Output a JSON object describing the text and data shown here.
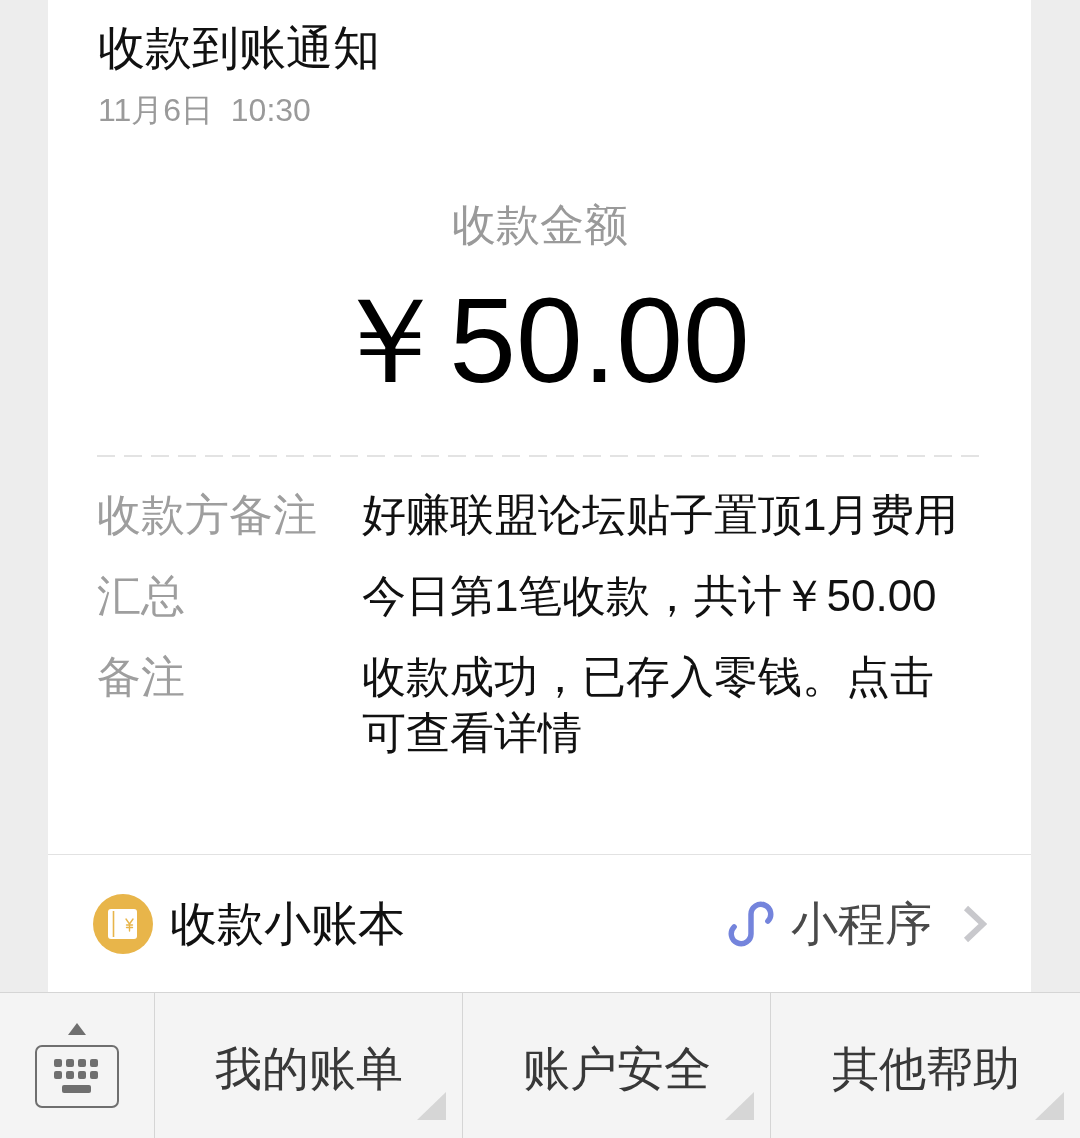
{
  "notification": {
    "title": "收款到账通知",
    "time": "11月6日  10:30"
  },
  "amount": {
    "label": "收款金额",
    "value": "￥50.00"
  },
  "details": [
    {
      "label": "收款方备注",
      "value": "好赚联盟论坛贴子置顶1月费用"
    },
    {
      "label": "汇总",
      "value": "今日第1笔收款，共计￥50.00"
    },
    {
      "label": "备注",
      "value": "收款成功，已存入零钱。点击可查看详情"
    }
  ],
  "footer": {
    "app_name": "收款小账本",
    "tag": "小程序"
  },
  "menu_bar": {
    "buttons": [
      {
        "label": "我的账单"
      },
      {
        "label": "账户安全"
      },
      {
        "label": "其他帮助"
      }
    ]
  }
}
